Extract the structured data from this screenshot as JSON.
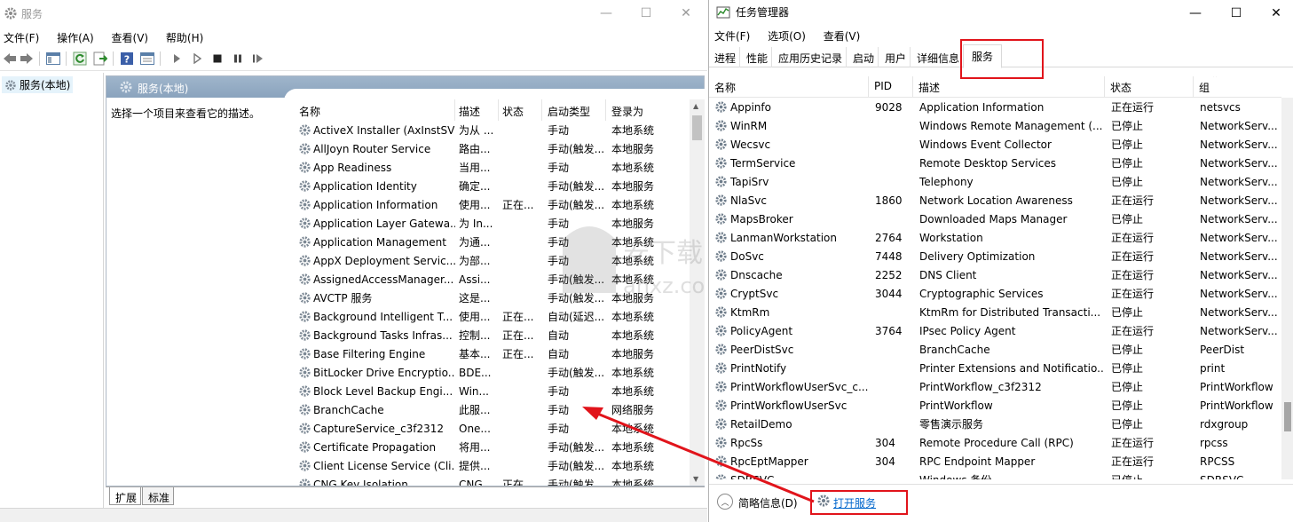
{
  "services_window": {
    "title": "服务",
    "menu": [
      "文件(F)",
      "操作(A)",
      "查看(V)",
      "帮助(H)"
    ],
    "tree_node": "服务(本地)",
    "pane_title": "服务(本地)",
    "select_hint": "选择一个项目来查看它的描述。",
    "columns": [
      "名称",
      "描述",
      "状态",
      "启动类型",
      "登录为"
    ],
    "rows": [
      {
        "name": "ActiveX Installer (AxInstSV)",
        "desc": "为从 ...",
        "status": "",
        "startup": "手动",
        "logon": "本地系统"
      },
      {
        "name": "AllJoyn Router Service",
        "desc": "路由...",
        "status": "",
        "startup": "手动(触发...",
        "logon": "本地服务"
      },
      {
        "name": "App Readiness",
        "desc": "当用...",
        "status": "",
        "startup": "手动",
        "logon": "本地系统"
      },
      {
        "name": "Application Identity",
        "desc": "确定...",
        "status": "",
        "startup": "手动(触发...",
        "logon": "本地服务"
      },
      {
        "name": "Application Information",
        "desc": "使用...",
        "status": "正在...",
        "startup": "手动(触发...",
        "logon": "本地系统"
      },
      {
        "name": "Application Layer Gatewa...",
        "desc": "为 In...",
        "status": "",
        "startup": "手动",
        "logon": "本地服务"
      },
      {
        "name": "Application Management",
        "desc": "为通...",
        "status": "",
        "startup": "手动",
        "logon": "本地系统"
      },
      {
        "name": "AppX Deployment Servic...",
        "desc": "为部...",
        "status": "",
        "startup": "手动",
        "logon": "本地系统"
      },
      {
        "name": "AssignedAccessManager...",
        "desc": "Assi...",
        "status": "",
        "startup": "手动(触发...",
        "logon": "本地系统"
      },
      {
        "name": "AVCTP 服务",
        "desc": "这是...",
        "status": "",
        "startup": "手动(触发...",
        "logon": "本地服务"
      },
      {
        "name": "Background Intelligent T...",
        "desc": "使用...",
        "status": "正在...",
        "startup": "自动(延迟...",
        "logon": "本地系统"
      },
      {
        "name": "Background Tasks Infras...",
        "desc": "控制...",
        "status": "正在...",
        "startup": "自动",
        "logon": "本地系统"
      },
      {
        "name": "Base Filtering Engine",
        "desc": "基本...",
        "status": "正在...",
        "startup": "自动",
        "logon": "本地服务"
      },
      {
        "name": "BitLocker Drive Encryptio...",
        "desc": "BDE...",
        "status": "",
        "startup": "手动(触发...",
        "logon": "本地系统"
      },
      {
        "name": "Block Level Backup Engi...",
        "desc": "Win...",
        "status": "",
        "startup": "手动",
        "logon": "本地系统"
      },
      {
        "name": "BranchCache",
        "desc": "此服...",
        "status": "",
        "startup": "手动",
        "logon": "网络服务"
      },
      {
        "name": "CaptureService_c3f2312",
        "desc": "One...",
        "status": "",
        "startup": "手动",
        "logon": "本地系统"
      },
      {
        "name": "Certificate Propagation",
        "desc": "将用...",
        "status": "",
        "startup": "手动(触发...",
        "logon": "本地系统"
      },
      {
        "name": "Client License Service (Cli...",
        "desc": "提供...",
        "status": "",
        "startup": "手动(触发...",
        "logon": "本地系统"
      },
      {
        "name": "CNG Key Isolation",
        "desc": "CNG...",
        "status": "正在...",
        "startup": "手动(触发...",
        "logon": "本地系统"
      }
    ],
    "bottom_tabs": [
      "扩展",
      "标准"
    ]
  },
  "task_manager": {
    "title": "任务管理器",
    "menu": [
      "文件(F)",
      "选项(O)",
      "查看(V)"
    ],
    "tabs": [
      "进程",
      "性能",
      "应用历史记录",
      "启动",
      "用户",
      "详细信息",
      "服务"
    ],
    "active_tab": "服务",
    "columns": [
      "名称",
      "PID",
      "描述",
      "状态",
      "组"
    ],
    "rows": [
      {
        "name": "Appinfo",
        "pid": "9028",
        "desc": "Application Information",
        "status": "正在运行",
        "group": "netsvcs"
      },
      {
        "name": "WinRM",
        "pid": "",
        "desc": "Windows Remote Management (...",
        "status": "已停止",
        "group": "NetworkServ..."
      },
      {
        "name": "Wecsvc",
        "pid": "",
        "desc": "Windows Event Collector",
        "status": "已停止",
        "group": "NetworkServ..."
      },
      {
        "name": "TermService",
        "pid": "",
        "desc": "Remote Desktop Services",
        "status": "已停止",
        "group": "NetworkServ..."
      },
      {
        "name": "TapiSrv",
        "pid": "",
        "desc": "Telephony",
        "status": "已停止",
        "group": "NetworkServ..."
      },
      {
        "name": "NlaSvc",
        "pid": "1860",
        "desc": "Network Location Awareness",
        "status": "正在运行",
        "group": "NetworkServ..."
      },
      {
        "name": "MapsBroker",
        "pid": "",
        "desc": "Downloaded Maps Manager",
        "status": "已停止",
        "group": "NetworkServ..."
      },
      {
        "name": "LanmanWorkstation",
        "pid": "2764",
        "desc": "Workstation",
        "status": "正在运行",
        "group": "NetworkServ..."
      },
      {
        "name": "DoSvc",
        "pid": "7448",
        "desc": "Delivery Optimization",
        "status": "正在运行",
        "group": "NetworkServ..."
      },
      {
        "name": "Dnscache",
        "pid": "2252",
        "desc": "DNS Client",
        "status": "正在运行",
        "group": "NetworkServ..."
      },
      {
        "name": "CryptSvc",
        "pid": "3044",
        "desc": "Cryptographic Services",
        "status": "正在运行",
        "group": "NetworkServ..."
      },
      {
        "name": "KtmRm",
        "pid": "",
        "desc": "KtmRm for Distributed Transacti...",
        "status": "已停止",
        "group": "NetworkServ..."
      },
      {
        "name": "PolicyAgent",
        "pid": "3764",
        "desc": "IPsec Policy Agent",
        "status": "正在运行",
        "group": "NetworkServ..."
      },
      {
        "name": "PeerDistSvc",
        "pid": "",
        "desc": "BranchCache",
        "status": "已停止",
        "group": "PeerDist"
      },
      {
        "name": "PrintNotify",
        "pid": "",
        "desc": "Printer Extensions and Notificatio...",
        "status": "已停止",
        "group": "print"
      },
      {
        "name": "PrintWorkflowUserSvc_c...",
        "pid": "",
        "desc": "PrintWorkflow_c3f2312",
        "status": "已停止",
        "group": "PrintWorkflow"
      },
      {
        "name": "PrintWorkflowUserSvc",
        "pid": "",
        "desc": "PrintWorkflow",
        "status": "已停止",
        "group": "PrintWorkflow"
      },
      {
        "name": "RetailDemo",
        "pid": "",
        "desc": "零售演示服务",
        "status": "已停止",
        "group": "rdxgroup"
      },
      {
        "name": "RpcSs",
        "pid": "304",
        "desc": "Remote Procedure Call (RPC)",
        "status": "正在运行",
        "group": "rpcss"
      },
      {
        "name": "RpcEptMapper",
        "pid": "304",
        "desc": "RPC Endpoint Mapper",
        "status": "正在运行",
        "group": "RPCSS"
      },
      {
        "name": "SDRSVC",
        "pid": "",
        "desc": "Windows 备份",
        "status": "已停止",
        "group": "SDRSVC"
      }
    ],
    "brief_info": "简略信息(D)",
    "open_services": "打开服务"
  },
  "colors": {
    "annotation_red": "#e1141b",
    "pane_header": "#8fa8c2",
    "link": "#0066cc"
  },
  "watermark_text": "安下载",
  "watermark_sub": "anxz.com"
}
